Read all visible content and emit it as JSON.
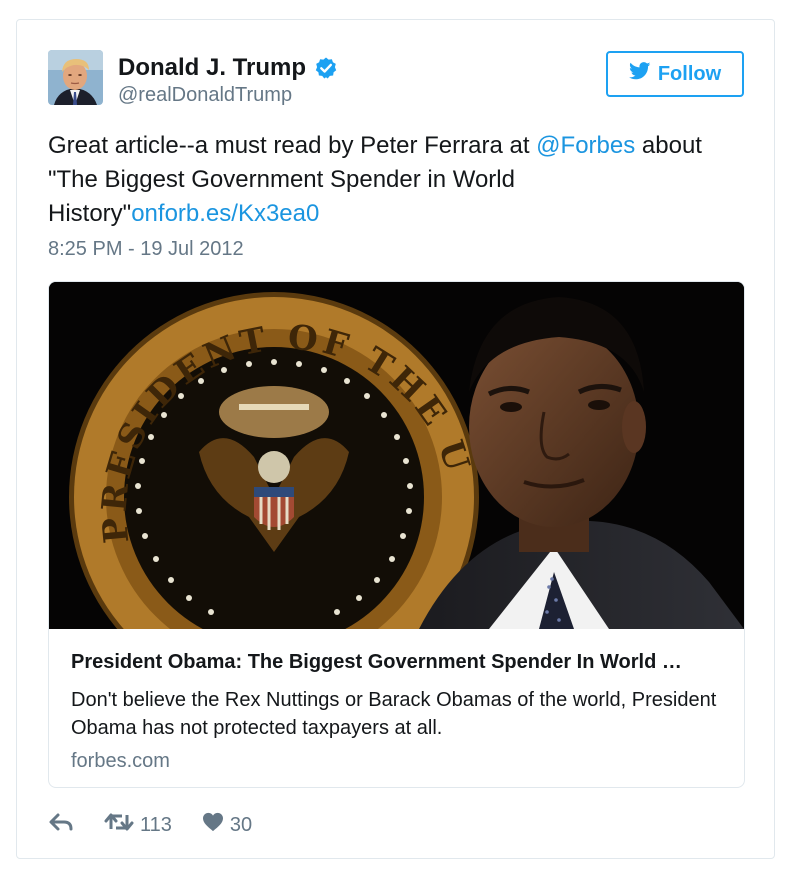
{
  "author": {
    "display_name": "Donald J. Trump",
    "handle": "@realDonaldTrump",
    "verified": true,
    "avatar_icon": "profile-photo"
  },
  "follow_button": {
    "label": "Follow",
    "icon": "twitter-bird-icon",
    "color": "#1da1f2"
  },
  "tweet": {
    "text_before": "Great article--a must read by Peter Ferrara at ",
    "mention": "@Forbes",
    "text_middle": " about \"The Biggest Government Spender in World History\"",
    "link": "onforb.es/Kx3ea0",
    "timestamp": "8:25 PM - 19 Jul 2012"
  },
  "card": {
    "image_alt": "President Obama in front of the presidential seal",
    "seal_text": "PRESIDENT OF THE UNITED STATES",
    "title": "President Obama: The Biggest Government Spender In World …",
    "description": "Don't believe the Rex Nuttings or Barack Obamas of the world, President Obama has not protected taxpayers at all.",
    "domain": "forbes.com"
  },
  "actions": {
    "reply_icon": "reply-icon",
    "retweet_icon": "retweet-icon",
    "retweet_count": "113",
    "like_icon": "heart-icon",
    "like_count": "30"
  },
  "colors": {
    "link": "#1b95e0",
    "muted": "#657786",
    "text": "#14171a",
    "border": "#e1e8ed"
  }
}
